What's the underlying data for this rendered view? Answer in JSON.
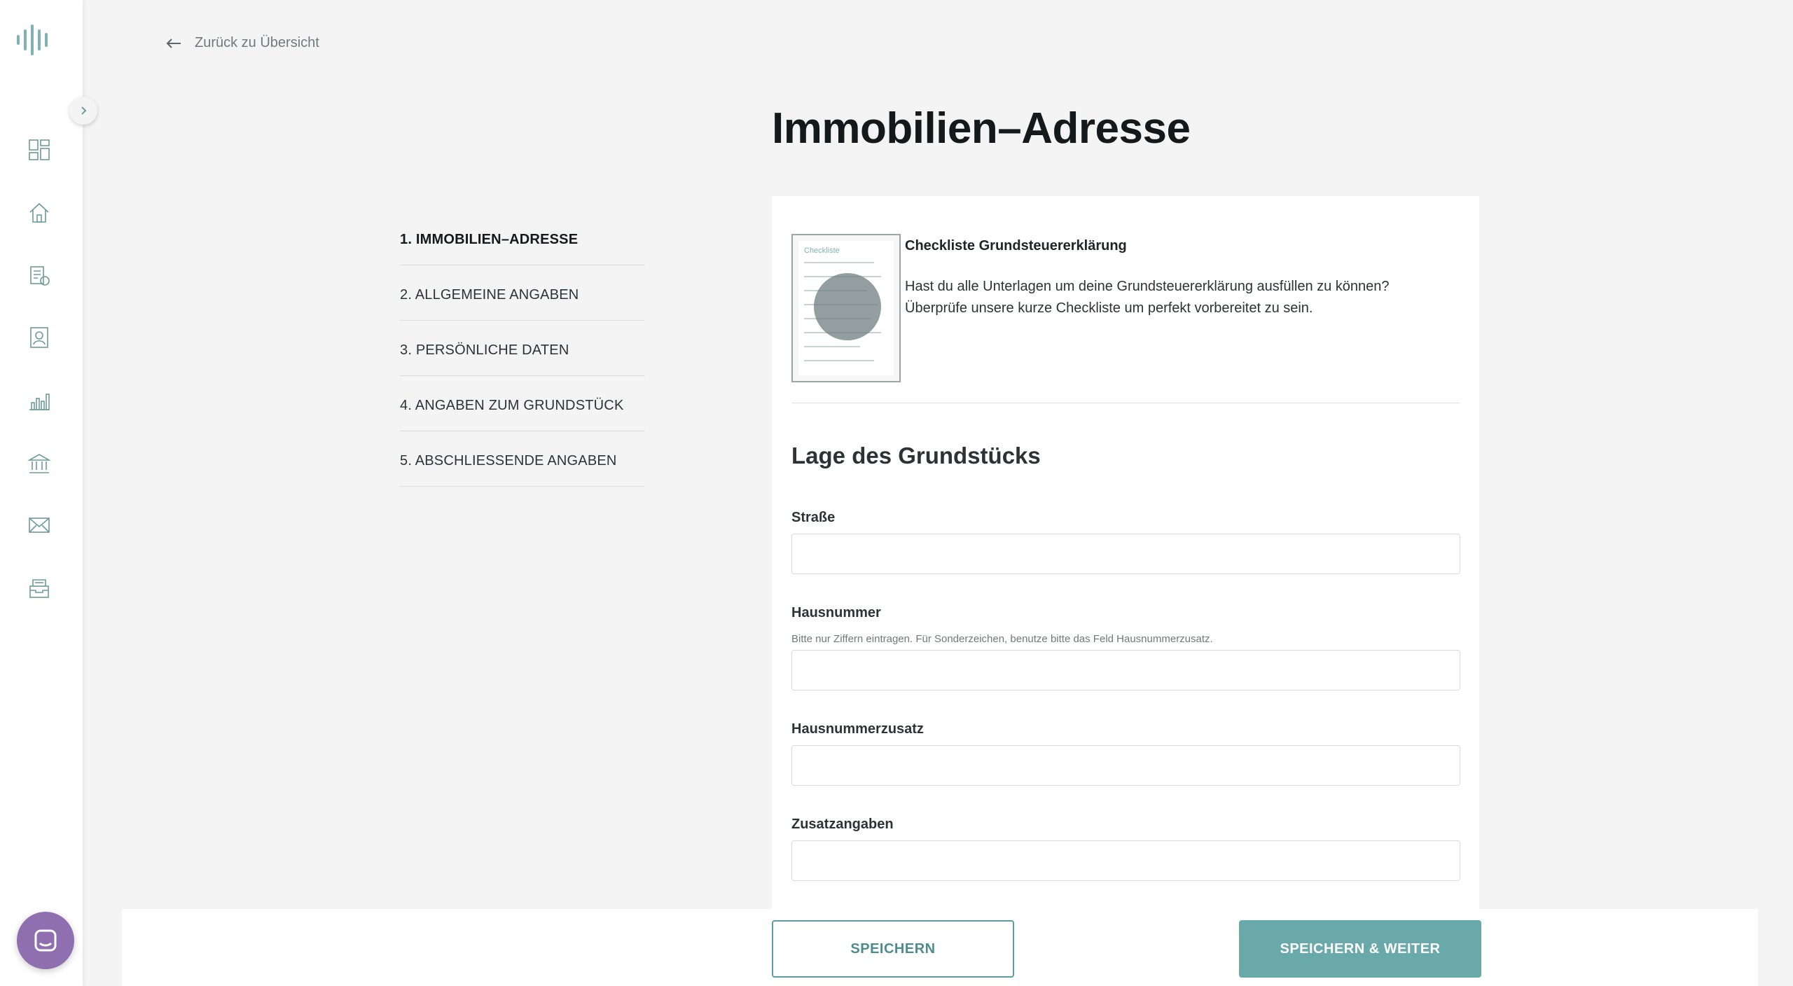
{
  "back_link": {
    "label": "Zurück zu Übersicht"
  },
  "page_title": "Immobilien–Adresse",
  "steps": [
    {
      "label": "1. IMMOBILIEN–ADRESSE",
      "active": true
    },
    {
      "label": "2. ALLGEMEINE ANGABEN",
      "active": false
    },
    {
      "label": "3. PERSÖNLICHE DATEN",
      "active": false
    },
    {
      "label": "4. ANGABEN ZUM GRUNDSTÜCK",
      "active": false
    },
    {
      "label": "5. ABSCHLIESSENDE ANGABEN",
      "active": false
    }
  ],
  "checklist": {
    "thumb_title": "Checkliste",
    "title": "Checkliste Grundsteuererklärung",
    "text": "Hast du alle Unterlagen um deine Grundsteuererklärung ausfüllen zu können? Überprüfe unsere kurze Checkliste um perfekt vorbereitet zu sein."
  },
  "section_title": "Lage des Grundstücks",
  "fields": {
    "strasse": {
      "label": "Straße",
      "value": ""
    },
    "hausnummer": {
      "label": "Hausnummer",
      "hint": "Bitte nur Ziffern eintragen. Für Sonderzeichen, benutze bitte das Feld Hausnummerzusatz.",
      "value": ""
    },
    "hausnummerzusatz": {
      "label": "Hausnummerzusatz",
      "value": ""
    },
    "zusatzangaben": {
      "label": "Zusatzangaben",
      "value": ""
    }
  },
  "buttons": {
    "save": "SPEICHERN",
    "save_next": "SPEICHERN & WEITER"
  },
  "sidebar_icons": [
    "dashboard-icon",
    "home-icon",
    "tax-document-icon",
    "contact-card-icon",
    "bar-chart-icon",
    "bank-icon",
    "mail-icon",
    "archive-icon"
  ],
  "colors": {
    "accent": "#6aa9aa",
    "accent_dark": "#4d8c8e",
    "chat": "#8f6fb0",
    "background": "#f4f4f4"
  }
}
